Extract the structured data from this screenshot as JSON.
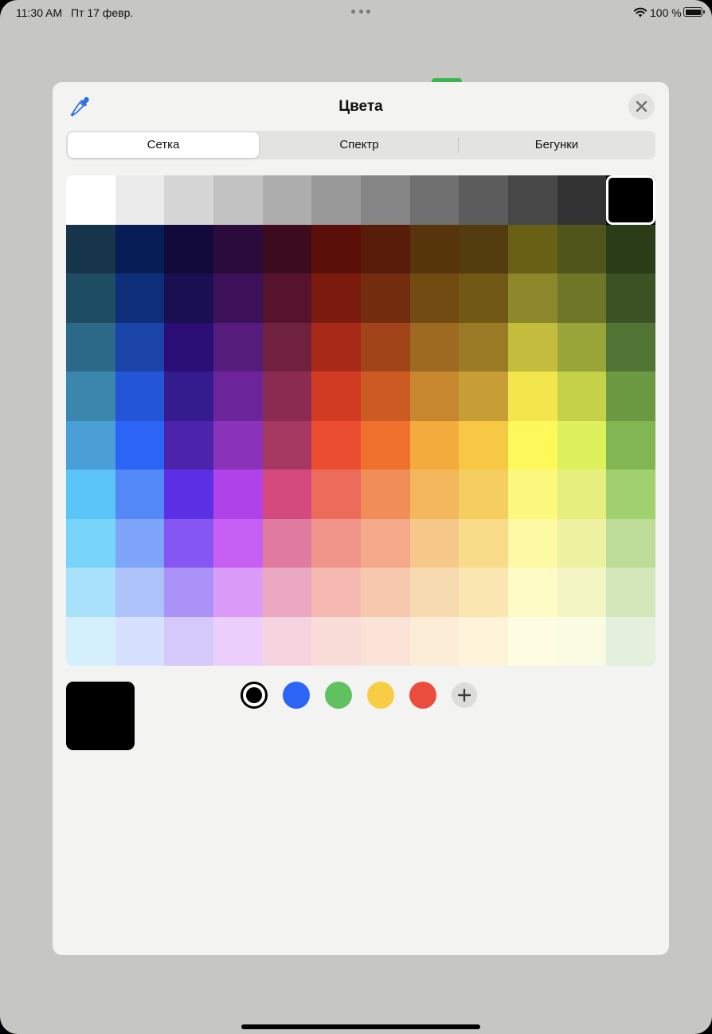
{
  "status_bar": {
    "time": "11:30 AM",
    "date": "Пт 17 февр.",
    "battery": "100 %"
  },
  "sheet": {
    "title": "Цвета",
    "eyedropper_icon": "eyedropper-icon",
    "close_icon": "close-icon"
  },
  "tabs": [
    {
      "label": "Сетка",
      "selected": true
    },
    {
      "label": "Спектр",
      "selected": false
    },
    {
      "label": "Бегунки",
      "selected": false
    }
  ],
  "grid": {
    "columns": 12,
    "selected": {
      "row": 0,
      "column": 11
    },
    "rows": [
      [
        "#ffffff",
        "#ebebeb",
        "#d6d6d6",
        "#c2c2c2",
        "#adadad",
        "#999999",
        "#858585",
        "#707070",
        "#5c5c5c",
        "#474747",
        "#333333",
        "#000000"
      ],
      [
        "#16354a",
        "#061d55",
        "#110a3a",
        "#2a0b3c",
        "#3c0c1e",
        "#5a1008",
        "#581d0a",
        "#553509",
        "#533c0e",
        "#676015",
        "#4f561a",
        "#2a3c18"
      ],
      [
        "#1e4d63",
        "#0e2e79",
        "#190f51",
        "#3d1159",
        "#55142c",
        "#7a1b0d",
        "#742c0f",
        "#724b13",
        "#715814",
        "#8b872a",
        "#6f7628",
        "#3a5224"
      ],
      [
        "#2c6988",
        "#1a44a7",
        "#2a0d75",
        "#561c7c",
        "#70213e",
        "#a72a18",
        "#a14419",
        "#9c6a21",
        "#9b7a25",
        "#c4bc3c",
        "#9aa539",
        "#527535"
      ],
      [
        "#3b86ac",
        "#2356d6",
        "#351c8e",
        "#6c249b",
        "#8c2b51",
        "#d03b22",
        "#cc5a23",
        "#c7872f",
        "#c79d36",
        "#f2e64c",
        "#c5d148",
        "#6c9a43"
      ],
      [
        "#4a9fd6",
        "#2c64f5",
        "#4b24ab",
        "#8a32b8",
        "#a53860",
        "#eb4d31",
        "#f0712e",
        "#f3ab3e",
        "#f6c844",
        "#fdf95b",
        "#def05c",
        "#82b652"
      ],
      [
        "#5ac4f6",
        "#5289f7",
        "#5b30e5",
        "#b042ea",
        "#d54a7e",
        "#ed6b5a",
        "#f08d58",
        "#f3b75c",
        "#f6cd5f",
        "#fdf87e",
        "#e6ee7d",
        "#a1d06e"
      ],
      [
        "#78d4f8",
        "#7ea5f9",
        "#8656f4",
        "#c660f5",
        "#e17a9f",
        "#f1958a",
        "#f4aa88",
        "#f6c98b",
        "#f8dc8a",
        "#fdf9a5",
        "#ecf2a0",
        "#bcdc97"
      ],
      [
        "#a9e0fa",
        "#afc3fb",
        "#ab92f6",
        "#da9cf8",
        "#eba8c1",
        "#f6b9b2",
        "#f7c8ae",
        "#f8dab0",
        "#f9e6b0",
        "#fefbc6",
        "#f3f6c4",
        "#d3e7bb"
      ],
      [
        "#d4f0fd",
        "#d7e1fd",
        "#d5c9fb",
        "#ebcefb",
        "#f5d4e0",
        "#fadcd8",
        "#fbe4d7",
        "#fcedd7",
        "#fcf3d8",
        "#fefde2",
        "#f9fbe2",
        "#e4efdc"
      ]
    ]
  },
  "current_color": "#000000",
  "favorites": {
    "colors": [
      "#000000",
      "#2c64f5",
      "#5fc15f",
      "#f6cd44",
      "#eb4d3d"
    ],
    "selected_index": 0,
    "add_icon": "plus-icon"
  }
}
